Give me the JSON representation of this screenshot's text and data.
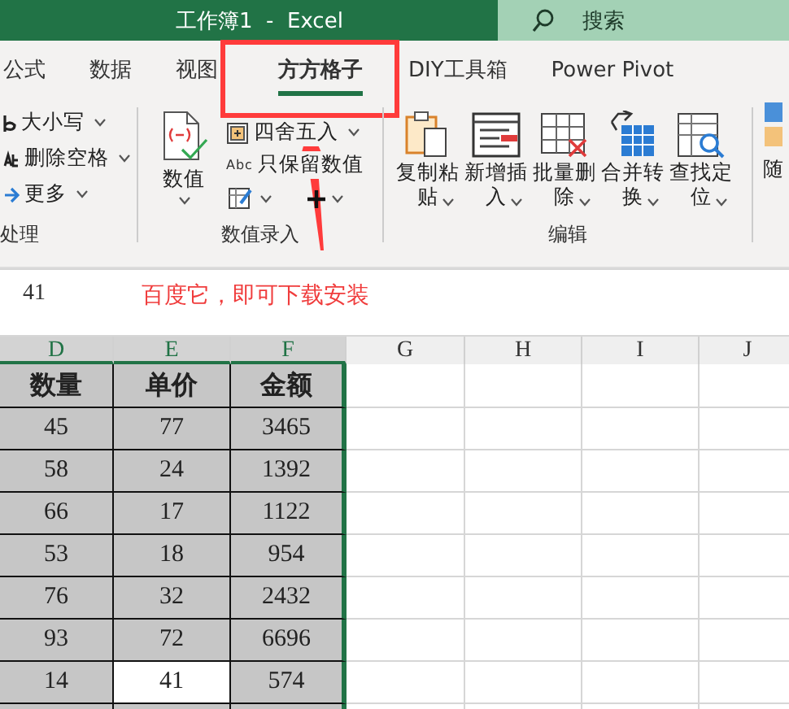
{
  "title_bar": {
    "title": "工作簿1  -  Excel",
    "search": {
      "placeholder": "搜索"
    }
  },
  "tabs": [
    {
      "label": "公式",
      "selected": false
    },
    {
      "label": "数据",
      "selected": false
    },
    {
      "label": "视图",
      "selected": false
    },
    {
      "label": "方方格子",
      "selected": true
    },
    {
      "label": "DIY工具箱",
      "selected": false
    },
    {
      "label": "Power Pivot",
      "selected": false
    }
  ],
  "ribbon": {
    "text_group": {
      "label": "处理",
      "buttons": [
        "大小写",
        "删除空格",
        "更多"
      ]
    },
    "number_group": {
      "label": "数值录入",
      "big_button": "数值",
      "buttons": [
        "四舍五入",
        "只保留数值"
      ],
      "abc_icon": "Abc"
    },
    "edit_group": {
      "label": "编辑",
      "buttons": [
        "复制粘贴",
        "新增插入",
        "批量删除",
        "合并转换",
        "查找定位"
      ]
    },
    "next_button": "随"
  },
  "formula_bar": {
    "value": "41"
  },
  "annotation": {
    "text": "百度它，即可下载安装"
  },
  "sheet": {
    "columns": [
      {
        "label": "D",
        "selected": true
      },
      {
        "label": "E",
        "selected": true
      },
      {
        "label": "F",
        "selected": true
      },
      {
        "label": "G",
        "selected": false
      },
      {
        "label": "H",
        "selected": false
      },
      {
        "label": "I",
        "selected": false
      },
      {
        "label": "J",
        "selected": false
      }
    ],
    "header_row": [
      "数量",
      "单价",
      "金额"
    ],
    "rows": [
      {
        "cells": [
          {
            "text": "45",
            "selected": false
          },
          {
            "text": "77",
            "selected": false
          },
          {
            "text": "3465",
            "selected": false
          }
        ]
      },
      {
        "cells": [
          {
            "text": "58",
            "selected": false
          },
          {
            "text": "24",
            "selected": false
          },
          {
            "text": "1392",
            "selected": false
          }
        ]
      },
      {
        "cells": [
          {
            "text": "66",
            "selected": false
          },
          {
            "text": "17",
            "selected": false
          },
          {
            "text": "1122",
            "selected": false
          }
        ]
      },
      {
        "cells": [
          {
            "text": "53",
            "selected": false
          },
          {
            "text": "18",
            "selected": false
          },
          {
            "text": "954",
            "selected": false
          }
        ]
      },
      {
        "cells": [
          {
            "text": "76",
            "selected": false
          },
          {
            "text": "32",
            "selected": false
          },
          {
            "text": "2432",
            "selected": false
          }
        ]
      },
      {
        "cells": [
          {
            "text": "93",
            "selected": false
          },
          {
            "text": "72",
            "selected": false
          },
          {
            "text": "6696",
            "selected": false
          }
        ]
      },
      {
        "cells": [
          {
            "text": "14",
            "selected": false
          },
          {
            "text": "41",
            "selected": true
          },
          {
            "text": "574",
            "selected": false
          }
        ]
      }
    ]
  }
}
